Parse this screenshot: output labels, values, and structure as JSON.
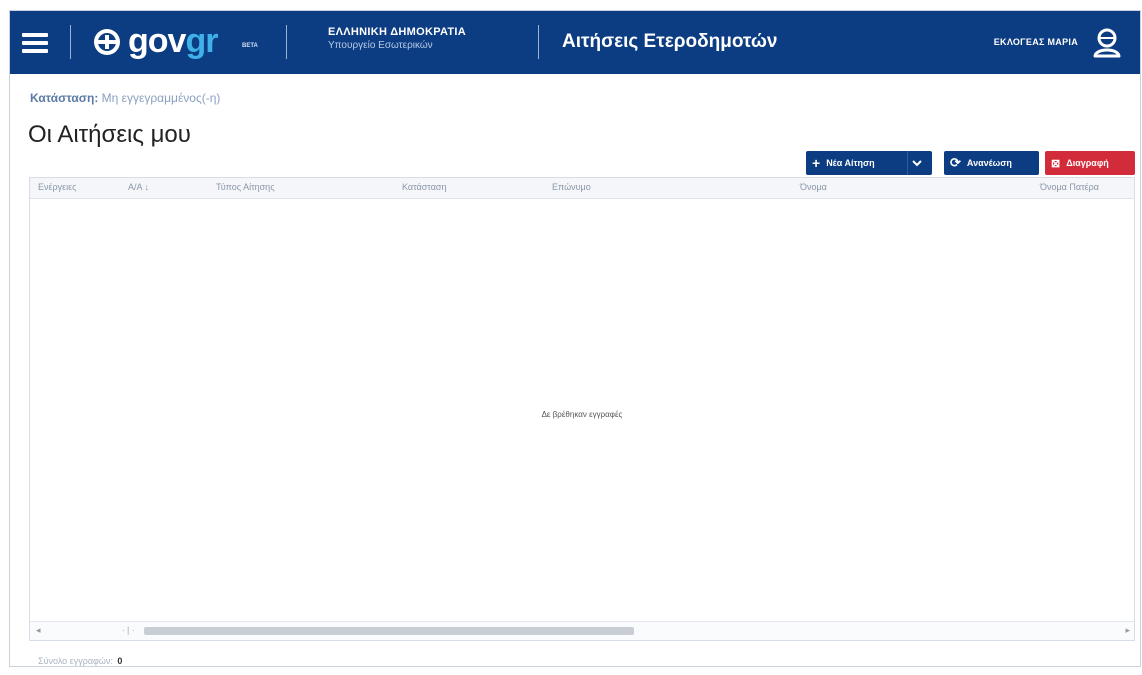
{
  "header": {
    "logo_main": "gov",
    "logo_accent": "gr",
    "logo_badge": "BETA",
    "ministry_line1": "ΕΛΛΗΝΙΚΗ ΔΗΜΟΚΡΑΤΙΑ",
    "ministry_line2": "Υπουργείο Εσωτερικών",
    "app_title": "Αιτήσεις Ετεροδημοτών",
    "user_name": "ΕΚΛΟΓΕΑΣ ΜΑΡΙΑ",
    "bg_color": "#0c3c82"
  },
  "status": {
    "label": "Κατάσταση:",
    "value": "Μη εγγεγραμμένος(-η)"
  },
  "page": {
    "title": "Οι Αιτήσεις μου"
  },
  "toolbar": {
    "new_label": "Νέα Αίτηση",
    "refresh_label": "Ανανέωση",
    "delete_label": "Διαγραφή",
    "primary_color": "#0c3c82",
    "danger_color": "#d22b3a"
  },
  "grid": {
    "columns": [
      "Ενέργειες",
      "Α/Α ↓",
      "Τύπος Αίτησης",
      "Κατάσταση",
      "Επώνυμο",
      "Όνομα",
      "Όνομα Πατέρα"
    ],
    "empty_message": "Δε βρέθηκαν εγγραφές",
    "rows": []
  },
  "footer": {
    "count_label": "Σύνολο εγγραφών:",
    "count_value": "0"
  }
}
